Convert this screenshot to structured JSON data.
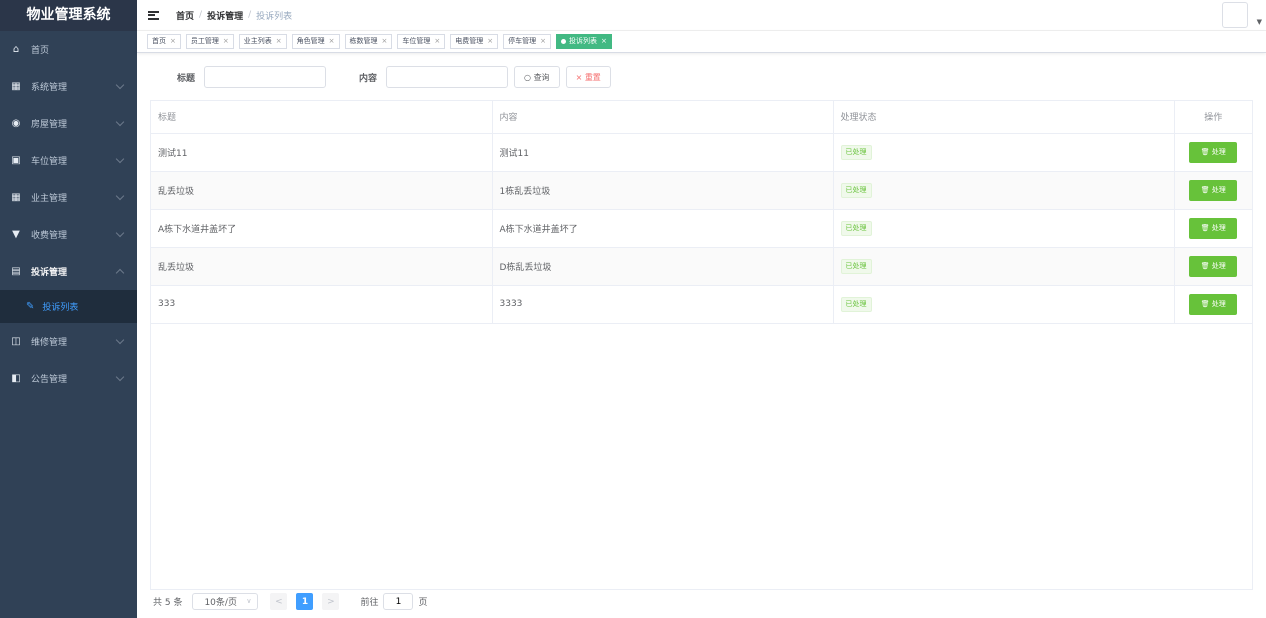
{
  "app_title": "物业管理系统",
  "sidebar": {
    "items": [
      {
        "label": "首页",
        "icon": "dashboard-icon",
        "glyph": "⌂"
      },
      {
        "label": "系统管理",
        "icon": "grid-icon",
        "glyph": "▦"
      },
      {
        "label": "房屋管理",
        "icon": "house-icon",
        "glyph": "◉"
      },
      {
        "label": "车位管理",
        "icon": "parking-icon",
        "glyph": "▣"
      },
      {
        "label": "业主管理",
        "icon": "table-icon",
        "glyph": "▦"
      },
      {
        "label": "收费管理",
        "icon": "payment-icon",
        "glyph": "▼"
      },
      {
        "label": "投诉管理",
        "icon": "calendar-icon",
        "glyph": "▤"
      },
      {
        "label": "维修管理",
        "icon": "chart-icon",
        "glyph": "◫"
      },
      {
        "label": "公告管理",
        "icon": "notice-icon",
        "glyph": "◧"
      }
    ],
    "sub_item": {
      "label": "投诉列表",
      "icon": "edit-icon",
      "glyph": "✎"
    }
  },
  "breadcrumb": [
    "首页",
    "投诉管理",
    "投诉列表"
  ],
  "tags": [
    "首页",
    "员工管理",
    "业主列表",
    "角色管理",
    "栋数管理",
    "车位管理",
    "电费管理",
    "停车管理",
    "投诉列表"
  ],
  "search": {
    "title_label": "标题",
    "title_value": "",
    "content_label": "内容",
    "content_value": "",
    "query_button": "查询",
    "reset_button": "重置"
  },
  "table": {
    "headers": [
      "标题",
      "内容",
      "处理状态",
      "操作"
    ],
    "rows": [
      {
        "title": "测试11",
        "content": "测试11",
        "status": "已处理",
        "action": "处理"
      },
      {
        "title": "乱丢垃圾",
        "content": "1栋乱丢垃圾",
        "status": "已处理",
        "action": "处理"
      },
      {
        "title": "A栋下水道井盖坏了",
        "content": "A栋下水道井盖坏了",
        "status": "已处理",
        "action": "处理"
      },
      {
        "title": "乱丢垃圾",
        "content": "D栋乱丢垃圾",
        "status": "已处理",
        "action": "处理"
      },
      {
        "title": "333",
        "content": "3333",
        "status": "已处理",
        "action": "处理"
      }
    ]
  },
  "pagination": {
    "total": "共 5 条",
    "page_size": "10条/页",
    "prev": "<",
    "current": "1",
    "next": ">",
    "goto_prefix": "前往",
    "goto_value": "1",
    "goto_suffix": "页"
  },
  "colors": {
    "sidebar_bg": "#304156",
    "active_tag": "#42b983",
    "primary": "#409eff",
    "success": "#67c23a",
    "danger": "#f56c6c"
  }
}
